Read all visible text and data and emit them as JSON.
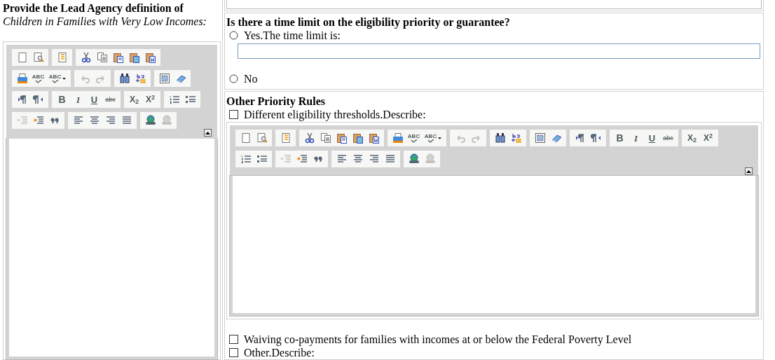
{
  "left": {
    "heading": "Provide the Lead Agency definition of",
    "subheading": "Children in Families with Very Low Incomes:"
  },
  "time_limit": {
    "question": "Is there a time limit on the eligibility priority or guarantee?",
    "options": [
      {
        "label": "Yes.The time limit is:",
        "selected": false
      },
      {
        "label": "No",
        "selected": false
      }
    ]
  },
  "priority_rules": {
    "title": "Other Priority Rules",
    "items": [
      {
        "label": "Different eligibility thresholds.Describe:",
        "checked": false,
        "kind": "editor"
      },
      {
        "label": "Waiving co-payments for families with incomes at or below the Federal Poverty Level",
        "checked": false,
        "kind": "plain"
      },
      {
        "label": "Other.Describe:",
        "checked": false,
        "kind": "plain"
      }
    ]
  },
  "toolbar_left": [
    [
      {
        "kind": "new",
        "disabled": false
      },
      {
        "kind": "preview",
        "disabled": false
      }
    ],
    [
      {
        "kind": "templates",
        "disabled": false
      }
    ],
    [
      {
        "kind": "cut",
        "disabled": false
      },
      {
        "kind": "copy",
        "disabled": false
      },
      {
        "kind": "paste",
        "disabled": false
      },
      {
        "kind": "paste-text",
        "disabled": false
      },
      {
        "kind": "paste-word",
        "disabled": false
      }
    ],
    [
      {
        "kind": "print",
        "disabled": false
      },
      {
        "kind": "spell",
        "label": "ABC",
        "disabled": false
      },
      {
        "kind": "spell-menu",
        "label": "ABC",
        "disabled": false
      }
    ],
    [
      {
        "kind": "undo",
        "disabled": true
      },
      {
        "kind": "redo",
        "disabled": true
      }
    ],
    [
      {
        "kind": "find",
        "disabled": false
      },
      {
        "kind": "replace",
        "disabled": false
      }
    ],
    [
      {
        "kind": "select-all",
        "disabled": false
      },
      {
        "kind": "remove-format",
        "disabled": false
      }
    ],
    [
      {
        "kind": "ltr",
        "disabled": false
      },
      {
        "kind": "rtl",
        "disabled": false
      }
    ],
    [
      {
        "kind": "bold",
        "label": "B",
        "disabled": false
      },
      {
        "kind": "italic",
        "label": "I",
        "disabled": false
      },
      {
        "kind": "underline",
        "label": "U",
        "disabled": false
      },
      {
        "kind": "strike",
        "label": "abc",
        "disabled": false
      }
    ],
    [
      {
        "kind": "sub",
        "label": "X$_{2}$",
        "disabled": false
      },
      {
        "kind": "sup",
        "label": "X$^{2}$",
        "disabled": false
      }
    ],
    [
      {
        "kind": "ol",
        "disabled": false
      },
      {
        "kind": "ul",
        "disabled": false
      }
    ],
    [
      {
        "kind": "outdent",
        "disabled": true
      },
      {
        "kind": "indent",
        "disabled": false
      },
      {
        "kind": "quote",
        "disabled": false
      }
    ],
    [
      {
        "kind": "align-left",
        "disabled": false
      },
      {
        "kind": "align-center",
        "disabled": false
      },
      {
        "kind": "align-right",
        "disabled": false
      },
      {
        "kind": "justify",
        "disabled": false
      }
    ],
    [
      {
        "kind": "link",
        "disabled": false
      },
      {
        "kind": "unlink",
        "disabled": true
      }
    ]
  ],
  "toolbar_right": [
    [
      {
        "kind": "new",
        "disabled": false
      },
      {
        "kind": "preview",
        "disabled": false
      }
    ],
    [
      {
        "kind": "templates",
        "disabled": false
      }
    ],
    [
      {
        "kind": "cut",
        "disabled": false
      },
      {
        "kind": "copy",
        "disabled": false
      },
      {
        "kind": "paste",
        "disabled": false
      },
      {
        "kind": "paste-text",
        "disabled": false
      },
      {
        "kind": "paste-word",
        "disabled": false
      }
    ],
    [
      {
        "kind": "print",
        "disabled": false
      },
      {
        "kind": "spell",
        "label": "ABC",
        "disabled": false
      },
      {
        "kind": "spell-menu",
        "label": "ABC",
        "disabled": false
      }
    ],
    [
      {
        "kind": "undo",
        "disabled": true
      },
      {
        "kind": "redo",
        "disabled": true
      }
    ],
    [
      {
        "kind": "find",
        "disabled": false
      },
      {
        "kind": "replace",
        "disabled": false
      }
    ],
    [
      {
        "kind": "select-all",
        "disabled": false
      },
      {
        "kind": "remove-format",
        "disabled": false
      }
    ],
    [
      {
        "kind": "ltr",
        "disabled": false
      },
      {
        "kind": "rtl",
        "disabled": false
      }
    ],
    [
      {
        "kind": "bold",
        "label": "B",
        "disabled": false
      },
      {
        "kind": "italic",
        "label": "I",
        "disabled": false
      },
      {
        "kind": "underline",
        "label": "U",
        "disabled": false
      },
      {
        "kind": "strike",
        "label": "abc",
        "disabled": false
      }
    ],
    [
      {
        "kind": "sub",
        "label": "X$_{2}$",
        "disabled": false
      },
      {
        "kind": "sup",
        "label": "X$^{2}$",
        "disabled": false
      }
    ],
    [
      {
        "kind": "ol",
        "disabled": false
      },
      {
        "kind": "ul",
        "disabled": false
      }
    ],
    [
      {
        "kind": "outdent",
        "disabled": true
      },
      {
        "kind": "indent",
        "disabled": false
      },
      {
        "kind": "quote",
        "disabled": false
      }
    ],
    [
      {
        "kind": "align-left",
        "disabled": false
      },
      {
        "kind": "align-center",
        "disabled": false
      },
      {
        "kind": "align-right",
        "disabled": false
      },
      {
        "kind": "justify",
        "disabled": false
      }
    ],
    [
      {
        "kind": "link",
        "disabled": false
      },
      {
        "kind": "unlink",
        "disabled": true
      }
    ]
  ]
}
